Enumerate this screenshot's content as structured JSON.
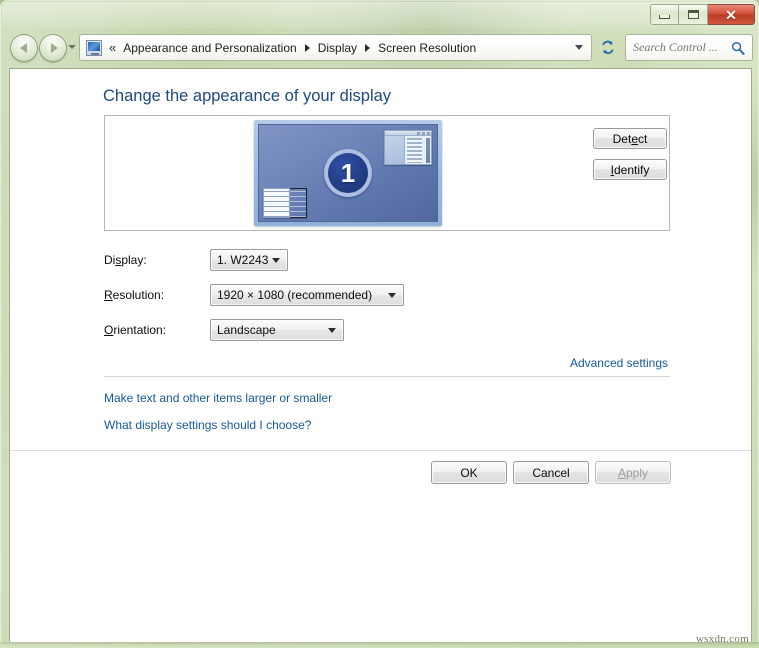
{
  "window": {
    "controls": {
      "minimize_label": "Minimize",
      "maximize_label": "Maximize",
      "close_label": "✕"
    }
  },
  "navbar": {
    "back_label": "Back",
    "forward_label": "Forward",
    "recent_pages_label": "Recent pages",
    "address_icon": "control-panel-icon",
    "overflow_indicator": "«",
    "breadcrumbs": [
      {
        "label": "Appearance and Personalization"
      },
      {
        "label": "Display"
      },
      {
        "label": "Screen Resolution"
      }
    ],
    "dropdown_label": "Previous locations",
    "refresh_label": "Refresh",
    "search": {
      "placeholder": "Search Control ...",
      "value": "",
      "icon": "search-icon"
    }
  },
  "main": {
    "page_title": "Change the appearance of your display",
    "preview": {
      "monitor_number": "1",
      "desktop_color": "#5d74ac",
      "badge_color": "#20397f"
    },
    "buttons": {
      "detect": {
        "label_pre": "Det",
        "accel": "e",
        "label_post": "ct",
        "disabled": false
      },
      "identify": {
        "label_pre": "",
        "accel": "I",
        "label_post": "dentify",
        "disabled": false
      }
    },
    "fields": [
      {
        "label_pre": "Di",
        "accel": "s",
        "label_post": "play:",
        "value": "1. W2243"
      },
      {
        "label_pre": "",
        "accel": "R",
        "label_post": "esolution:",
        "value": "1920 × 1080 (recommended)"
      },
      {
        "label_pre": "",
        "accel": "O",
        "label_post": "rientation:",
        "value": "Landscape"
      }
    ],
    "links": {
      "advanced_settings": "Advanced settings",
      "make_text_larger": "Make text and other items larger or smaller",
      "what_settings": "What display settings should I choose?"
    },
    "commands": {
      "ok": {
        "label": "OK",
        "disabled": false
      },
      "cancel": {
        "label": "Cancel",
        "disabled": false
      },
      "apply": {
        "label_pre": "",
        "accel": "A",
        "label_post": "pply",
        "disabled": true
      }
    }
  },
  "watermark": "wsxdn.com"
}
